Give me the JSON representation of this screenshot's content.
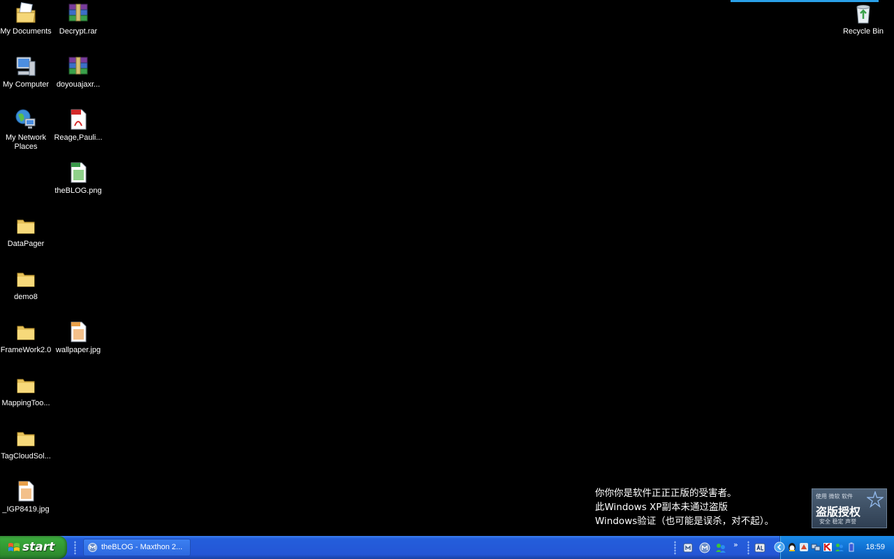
{
  "desktop": {
    "icons": {
      "my_documents": "My Documents",
      "decrypt": "Decrypt.rar",
      "recycle_bin": "Recycle Bin",
      "my_computer": "My Computer",
      "doyouajax": "doyouajaxr...",
      "my_network_places": "My Network Places",
      "reage_pauli": "Reage,Pauli...",
      "theblog_png": "theBLOG.png",
      "datapager": "DataPager",
      "demo8": "demo8",
      "framework": "FrameWork2.0",
      "wallpaper": "wallpaper.jpg",
      "mapping_tool": "MappingToo...",
      "tag_cloud": "TagCloudSol...",
      "igp8419": "_IGP8419.jpg"
    },
    "piracy_notice": {
      "line1": "你你你是软件正正正版的受害者。",
      "line2": "此Windows XP副本未通过盗版",
      "line3": "Windows验证（也可能是误杀，对不起）。"
    },
    "piracy_badge": {
      "top": "使用 微软 软件",
      "main": "盗版授权",
      "bottom": "安全 稳定 声誉"
    }
  },
  "taskbar": {
    "start_label": "start",
    "active_window": "theBLOG - Maxthon 2...",
    "overflow": "»",
    "clock": "18:59"
  },
  "icon_names": {
    "start": "windows-flag-icon",
    "task": "maxthon-icon"
  },
  "colors": {
    "taskbar": "#245edb",
    "start_button": "#38a83a",
    "tray": "#0f6dcf"
  }
}
